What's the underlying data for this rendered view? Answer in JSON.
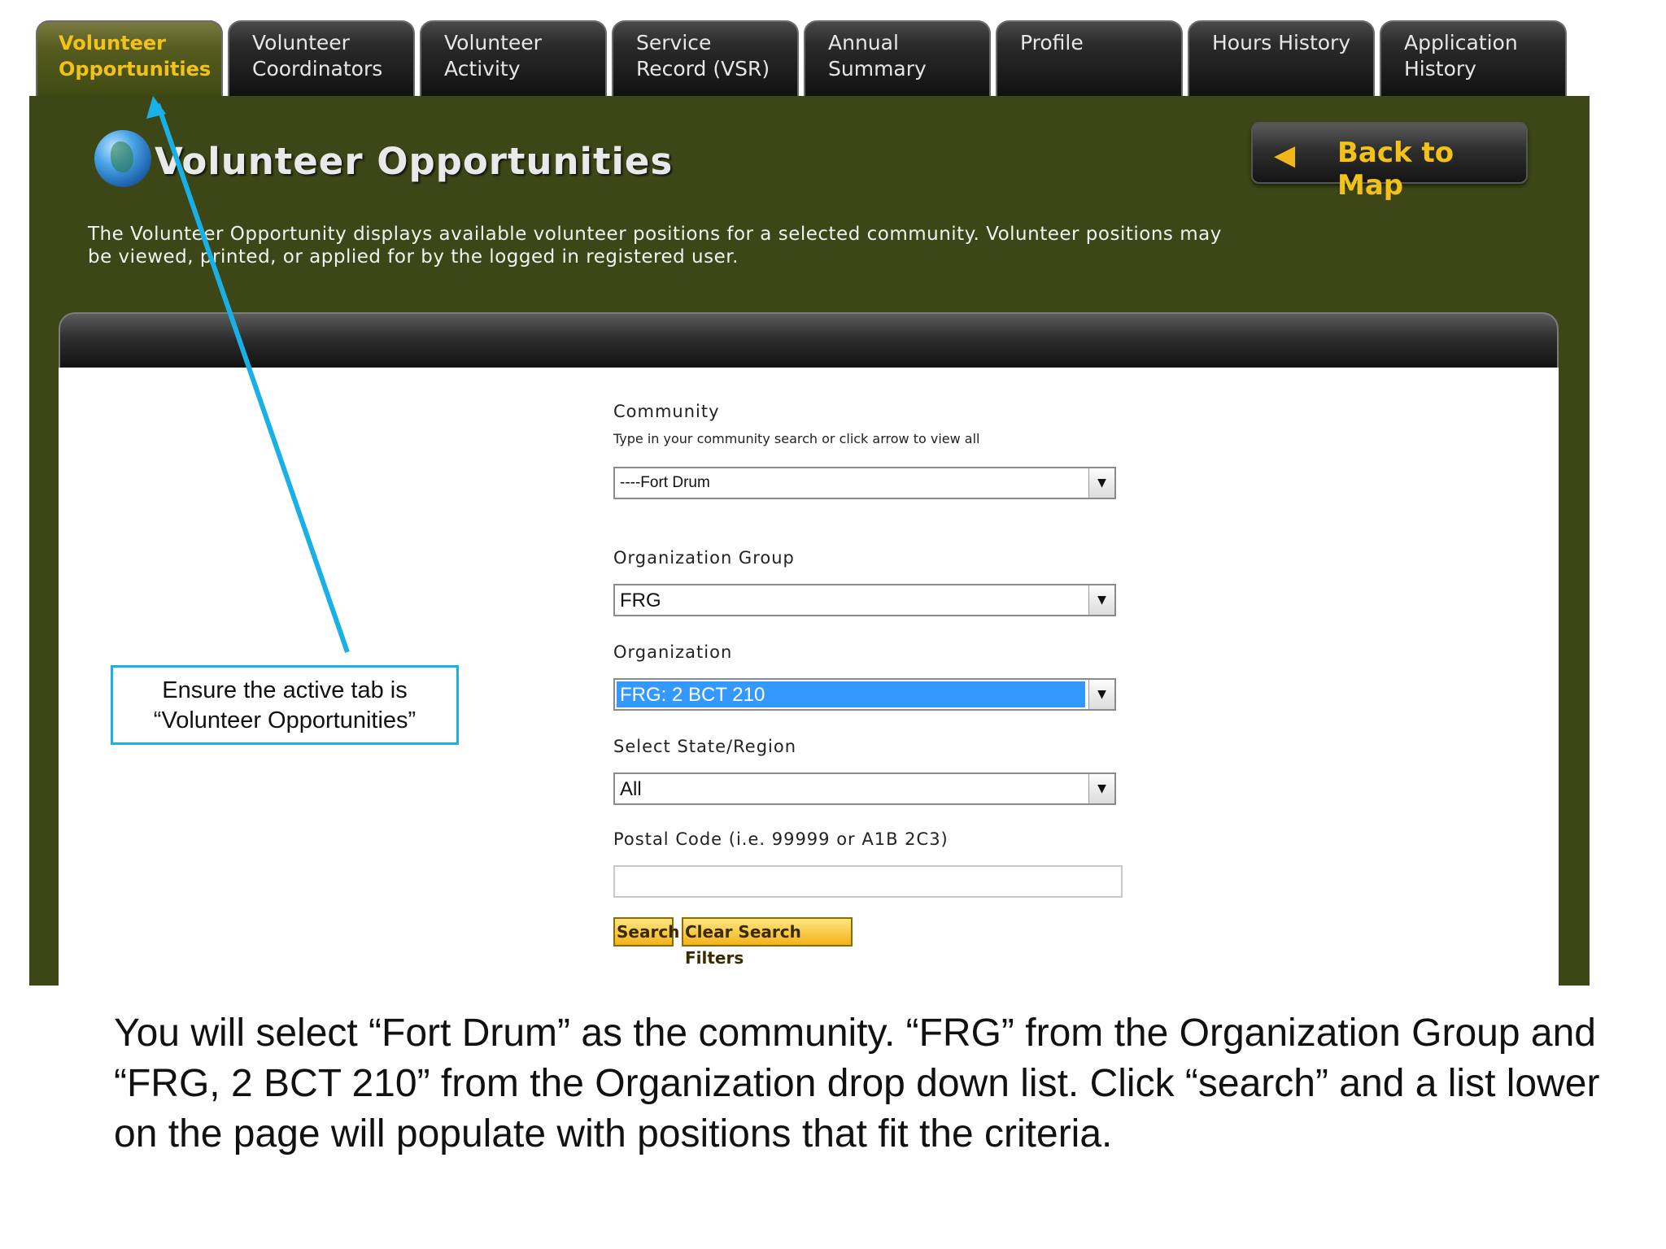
{
  "tabs": [
    {
      "label": "Volunteer\nOpportunities",
      "active": true
    },
    {
      "label": "Volunteer\nCoordinators",
      "active": false
    },
    {
      "label": "Volunteer\nActivity",
      "active": false
    },
    {
      "label": "Service\nRecord (VSR)",
      "active": false
    },
    {
      "label": "Annual\nSummary",
      "active": false
    },
    {
      "label": "Profile",
      "active": false
    },
    {
      "label": "Hours History",
      "active": false
    },
    {
      "label": "Application\nHistory",
      "active": false
    }
  ],
  "header": {
    "title": "Volunteer Opportunities",
    "title_icon": "globe-icon",
    "back_button": {
      "label": "Back to Map",
      "icon": "arrow-left-icon"
    },
    "intro": "The Volunteer Opportunity displays available volunteer positions for a selected community. Volunteer positions may be viewed, printed, or applied for by the logged in registered user."
  },
  "form": {
    "community": {
      "label": "Community",
      "hint": "Type in your community search or click arrow to view all",
      "value": "----Fort Drum"
    },
    "org_group": {
      "label": "Organization Group",
      "value": "FRG"
    },
    "organization": {
      "label": "Organization",
      "value": "FRG: 2 BCT 210"
    },
    "state": {
      "label": "Select State/Region",
      "value": "All"
    },
    "postal": {
      "label": "Postal Code (i.e. 99999 or A1B 2C3)",
      "value": ""
    },
    "search_label": "Search",
    "clear_label": "Clear Search Filters"
  },
  "annotation": {
    "callout": "Ensure the active tab is “Volunteer Opportunities”",
    "caption": "You will select “Fort Drum” as the community.  “FRG” from the Organization Group and “FRG, 2 BCT 210” from the Organization drop down list.  Click “search” and a list lower on the page will populate with positions that fit the criteria."
  },
  "colors": {
    "panel": "#3d4616",
    "active_tab_text": "#f2c21a",
    "highlight": "#3399ff",
    "annotation": "#19b0e6",
    "button": "#f2b31a"
  }
}
